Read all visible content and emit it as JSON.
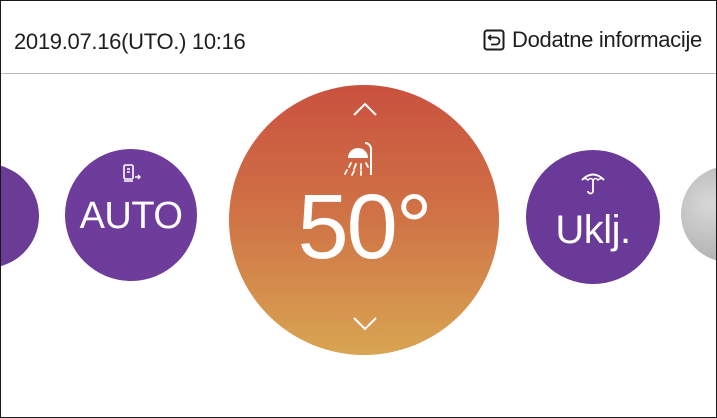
{
  "header": {
    "datetime": "2019.07.16(UTO.)  10:16",
    "info_link": "Dodatne informacije",
    "info_icon": "back-arrow-icon"
  },
  "mode": {
    "label": "AUTO",
    "icon": "thermostat-auto-icon"
  },
  "temperature": {
    "value": "50°",
    "icon": "shower-icon"
  },
  "power": {
    "label": "Uklj.",
    "icon": "umbrella-icon"
  },
  "colors": {
    "purple": "#6e3c9a",
    "temp_top": "#c9513f",
    "temp_bottom": "#d8a552",
    "grey": "#a8a8a8"
  }
}
